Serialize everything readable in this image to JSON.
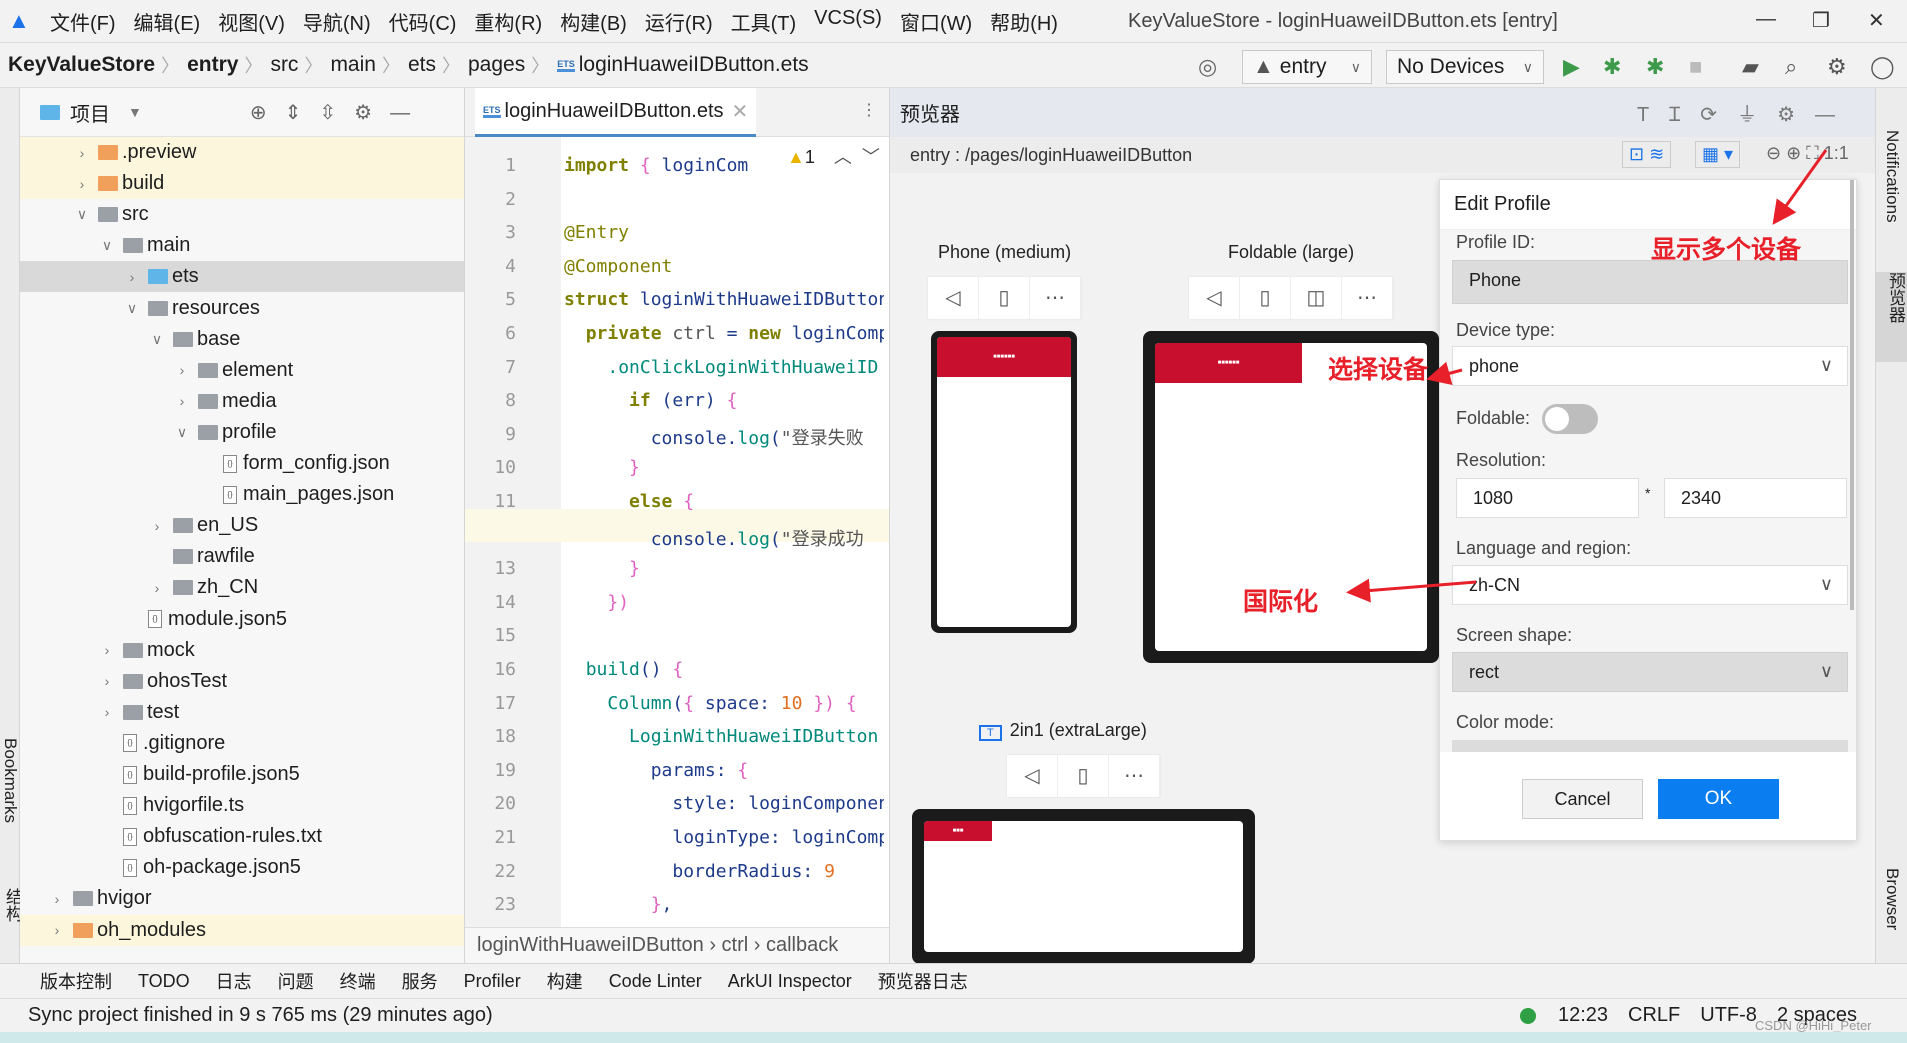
{
  "menu": [
    "文件(F)",
    "编辑(E)",
    "视图(V)",
    "导航(N)",
    "代码(C)",
    "重构(R)",
    "构建(B)",
    "运行(R)",
    "工具(T)",
    "VCS(S)",
    "窗口(W)",
    "帮助(H)"
  ],
  "window_title": "KeyValueStore - loginHuaweiIDButton.ets [entry]",
  "breadcrumb": [
    "KeyValueStore",
    "entry",
    "src",
    "main",
    "ets",
    "pages",
    "loginHuaweiIDButton.ets"
  ],
  "toolbar": {
    "module": "entry",
    "device": "No Devices"
  },
  "project": {
    "title": "项目",
    "tree": [
      {
        "label": ".preview",
        "depth": 2,
        "type": "folder-orange",
        "expand": ">",
        "style": "yellow"
      },
      {
        "label": "build",
        "depth": 2,
        "type": "folder-orange",
        "expand": ">",
        "style": "yellow"
      },
      {
        "label": "src",
        "depth": 2,
        "type": "folder",
        "expand": "v"
      },
      {
        "label": "main",
        "depth": 3,
        "type": "folder",
        "expand": "v"
      },
      {
        "label": "ets",
        "depth": 4,
        "type": "folder-blue",
        "expand": ">",
        "style": "sel"
      },
      {
        "label": "resources",
        "depth": 4,
        "type": "folder",
        "expand": "v"
      },
      {
        "label": "base",
        "depth": 5,
        "type": "folder",
        "expand": "v"
      },
      {
        "label": "element",
        "depth": 6,
        "type": "folder",
        "expand": ">"
      },
      {
        "label": "media",
        "depth": 6,
        "type": "folder",
        "expand": ">"
      },
      {
        "label": "profile",
        "depth": 6,
        "type": "folder",
        "expand": "v"
      },
      {
        "label": "form_config.json",
        "depth": 7,
        "type": "file"
      },
      {
        "label": "main_pages.json",
        "depth": 7,
        "type": "file"
      },
      {
        "label": "en_US",
        "depth": 5,
        "type": "folder",
        "expand": ">"
      },
      {
        "label": "rawfile",
        "depth": 5,
        "type": "folder"
      },
      {
        "label": "zh_CN",
        "depth": 5,
        "type": "folder",
        "expand": ">"
      },
      {
        "label": "module.json5",
        "depth": 4,
        "type": "file"
      },
      {
        "label": "mock",
        "depth": 3,
        "type": "folder",
        "expand": ">"
      },
      {
        "label": "ohosTest",
        "depth": 3,
        "type": "folder",
        "expand": ">"
      },
      {
        "label": "test",
        "depth": 3,
        "type": "folder",
        "expand": ">"
      },
      {
        "label": ".gitignore",
        "depth": 3,
        "type": "file"
      },
      {
        "label": "build-profile.json5",
        "depth": 3,
        "type": "file"
      },
      {
        "label": "hvigorfile.ts",
        "depth": 3,
        "type": "file"
      },
      {
        "label": "obfuscation-rules.txt",
        "depth": 3,
        "type": "file"
      },
      {
        "label": "oh-package.json5",
        "depth": 3,
        "type": "file"
      },
      {
        "label": "hvigor",
        "depth": 1,
        "type": "folder",
        "expand": ">"
      },
      {
        "label": "oh_modules",
        "depth": 1,
        "type": "folder-orange",
        "expand": ">",
        "style": "yellow"
      }
    ]
  },
  "editor": {
    "tab": "loginHuaweiIDButton.ets",
    "warnings": "1",
    "breadcrumb": "loginWithHuaweiIDButton  ›  ctrl  ›  callback",
    "lines": [
      "<span class='kw'>import</span> <span class='br'>{</span> loginCom",
      "",
      "<span class='an'>@Entry</span>",
      "<span class='an'>@Component</span>",
      "<span class='kw'>struct</span> loginWithHuaweiIDButton",
      "  <span class='kw'>private</span> <span class='str'>ctrl</span> = <span class='kw'>new</span> loginComponent",
      "    <span class='fn'>.onClickLoginWithHuaweiID</span>",
      "      <span class='kw'>if</span> (err) <span class='br'>{</span>",
      "        console.<span class='fn'>log</span>(<span class='str'>\"登录失败</span>",
      "      <span class='br'>}</span>",
      "      <span class='kw'>else</span> <span class='br'>{</span>",
      "        console.<span class='fn'>log</span>(<span class='str'>\"登录成功</span>",
      "      <span class='br'>}</span>",
      "    <span class='br'>})</span>",
      "",
      "  <span class='fn'>build</span>() <span class='br'>{</span>",
      "    <span class='fn'>Column</span>(<span class='br'>{</span> space: <span class='num'>10</span> <span class='br'>})</span> <span class='br'>{</span>",
      "      <span class='fn'>LoginWithHuaweiIDButton</span>",
      "        params: <span class='br'>{</span>",
      "          style: loginComponent",
      "          loginType: loginComponent",
      "          borderRadius: <span class='num'>9</span>",
      "        <span class='br'>}</span>,"
    ]
  },
  "preview": {
    "title": "预览器",
    "path": "entry : /pages/loginHuaweiIDButton",
    "zoom_label": "1:1",
    "devices": [
      {
        "name": "Phone (medium)"
      },
      {
        "name": "Foldable (large)"
      },
      {
        "name": "2in1 (extraLarge)"
      }
    ]
  },
  "dialog": {
    "title": "Edit Profile",
    "profile_id_label": "Profile ID:",
    "profile_id": "Phone",
    "device_type_label": "Device type:",
    "device_type": "phone",
    "foldable_label": "Foldable:",
    "foldable": false,
    "resolution_label": "Resolution:",
    "res_w": "1080",
    "res_x": "*",
    "res_h": "2340",
    "lang_label": "Language and region:",
    "lang": "zh-CN",
    "shape_label": "Screen shape:",
    "shape": "rect",
    "color_label": "Color mode:",
    "cancel": "Cancel",
    "ok": "OK",
    "accent": "#0a7df0"
  },
  "annotations": {
    "multi": "显示多个设备",
    "select": "选择设备",
    "i18n": "国际化",
    "color": "#e8202a"
  },
  "right_strip": {
    "notifications": "Notifications",
    "previewer": "预览器",
    "device_browser": "Device File Browser"
  },
  "left_strip": {
    "bookmarks": "Bookmarks",
    "structure": "结构"
  },
  "toolwindows": [
    "版本控制",
    "TODO",
    "日志",
    "问题",
    "终端",
    "服务",
    "Profiler",
    "构建",
    "Code Linter",
    "ArkUI Inspector",
    "预览器日志"
  ],
  "status": {
    "message": "Sync project finished in 9 s 765 ms (29 minutes ago)",
    "position": "12:23",
    "line_sep": "CRLF",
    "encoding": "UTF-8",
    "indent": "2 spaces",
    "watermark": "CSDN @HiHi_Peter"
  }
}
